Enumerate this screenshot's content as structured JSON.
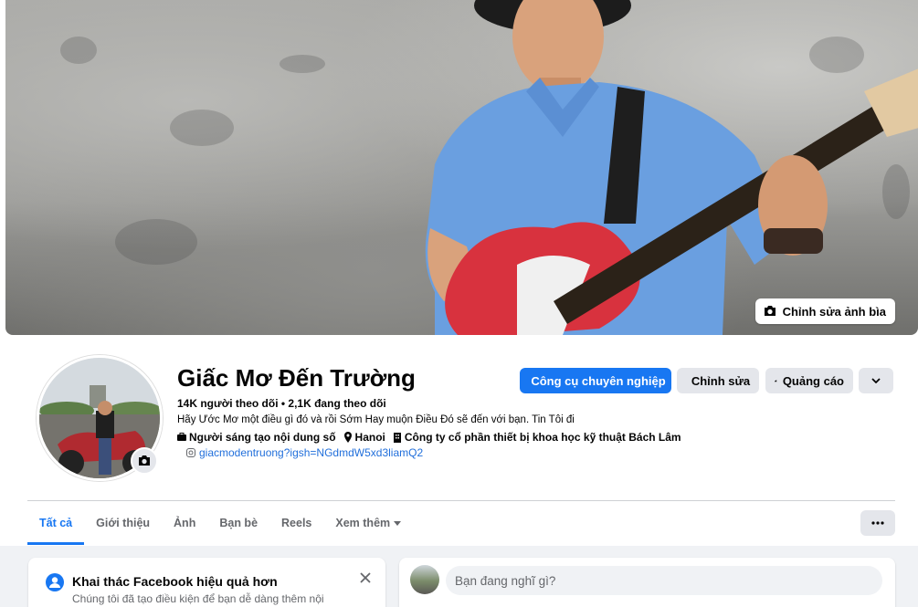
{
  "profile": {
    "name": "Giấc Mơ Đến Trường",
    "followers": "14K người theo dõi • 2,1K đang theo dõi",
    "bio": "Hãy Ước Mơ một điều gì đó và rồi Sớm Hay muộn Điều Đó sẽ đến với bạn. Tin Tôi đi",
    "category": "Người sáng tạo nội dung số",
    "location": "Hanoi",
    "workplace": "Công ty cổ phần thiết bị khoa học kỹ thuật Bách Lâm",
    "link": "giacmodentruong?igsh=NGdmdW5xd3liamQ2"
  },
  "cover": {
    "edit_label": "Chỉnh sửa ảnh bìa"
  },
  "actions": {
    "pro_tools": "Công cụ chuyên nghiệp",
    "edit": "Chỉnh sửa",
    "ads": "Quảng cáo"
  },
  "tabs": [
    {
      "label": "Tất cả",
      "active": true
    },
    {
      "label": "Giới thiệu"
    },
    {
      "label": "Ảnh"
    },
    {
      "label": "Bạn bè"
    },
    {
      "label": "Reels"
    },
    {
      "label": "Xem thêm"
    }
  ],
  "tip_card": {
    "title": "Khai thác Facebook hiệu quả hơn",
    "text": "Chúng tôi đã tạo điều kiện để bạn dễ dàng thêm nội"
  },
  "composer": {
    "placeholder": "Bạn đang nghĩ gì?"
  },
  "colors": {
    "accent": "#1877f2",
    "link": "#216fdb",
    "button_grey": "#e4e6eb",
    "background": "#f0f2f5"
  },
  "icons": [
    "camera-icon",
    "chart-icon",
    "pencil-icon",
    "megaphone-icon",
    "chevron-down-icon",
    "briefcase-icon",
    "location-pin-icon",
    "building-icon",
    "instagram-icon",
    "more-icon",
    "info-user-icon",
    "close-icon"
  ]
}
